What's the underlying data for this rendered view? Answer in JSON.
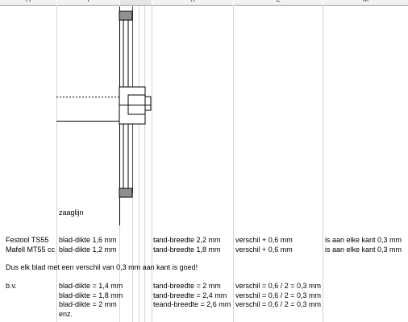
{
  "column_headers": [
    "H",
    "I",
    "J",
    "K",
    "L",
    "M"
  ],
  "drawing": {
    "label": "zaaglijn"
  },
  "saws": [
    {
      "name": "Festool TS55",
      "blade": "blad-dikte 1,6 mm",
      "tooth": "tand-breedte 2,2 mm",
      "diff": "verschil + 0,6 mm",
      "side": "is aan elke kant 0,3 mm"
    },
    {
      "name": "Mafell MT55 cc",
      "blade": "blad-dikte 1,2 mm",
      "tooth": "tand-breedte 1,8 mm",
      "diff": "verschil + 0,6 mm",
      "side": "is aan elke kant 0,3 mm"
    }
  ],
  "conclusion": "Dus elk blad met een verschil van 0,3 mm aan kant is goed!",
  "examples": {
    "label": "b.v.",
    "rows": [
      {
        "blade": "blad-dikte = 1,4 mm",
        "tooth": "tand-breedte = 2 mm",
        "diff": "verschil = 0,6 / 2 = 0,3 mm"
      },
      {
        "blade": "blad-dikte = 1,8 mm",
        "tooth": "tand-breedte = 2,4 mm",
        "diff": "verschil = 0,6 / 2 = 0,3 mm"
      },
      {
        "blade": "blad-dikte = 2 mm",
        "tooth": "teand-breedte = 2,6 mm",
        "diff": "verschil = 0,6 / 2 = 0,3 mm"
      }
    ],
    "etc": "enz."
  }
}
